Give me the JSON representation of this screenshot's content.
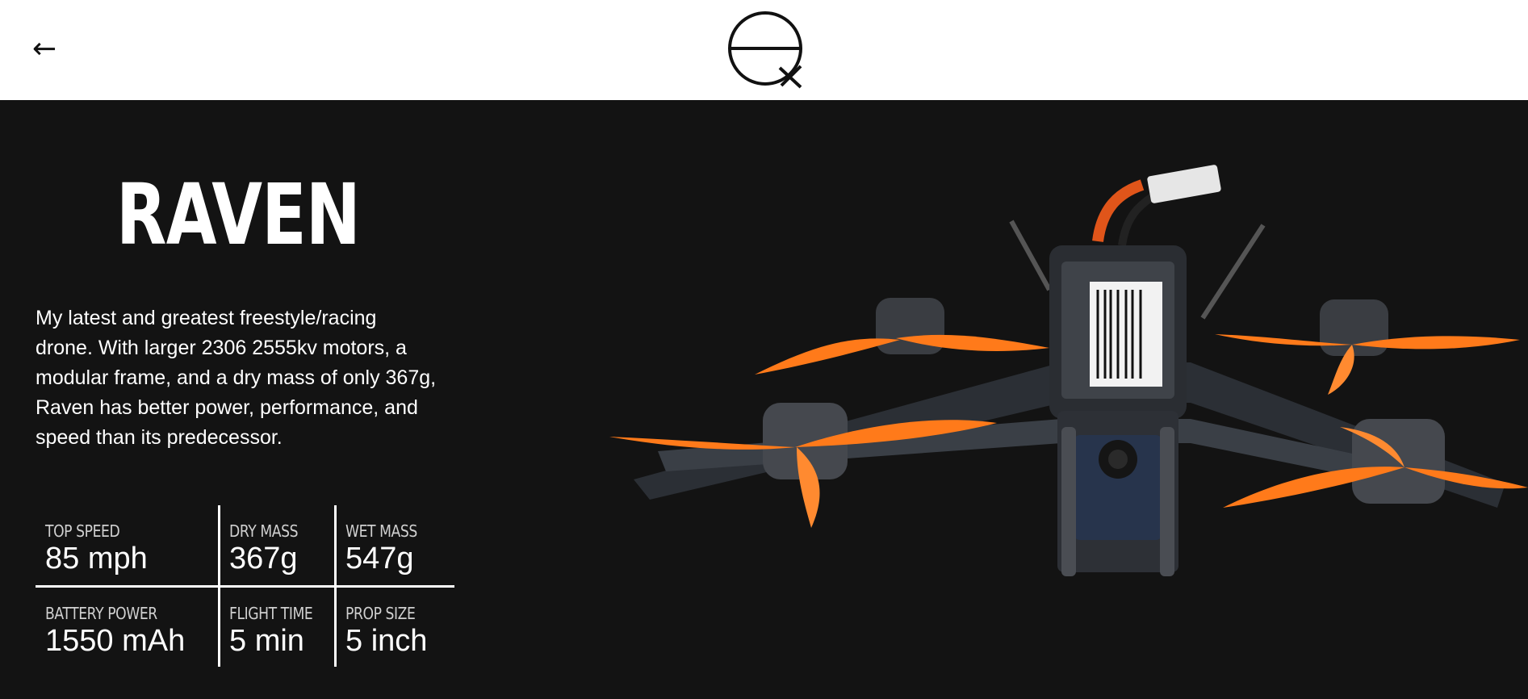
{
  "header": {
    "back_icon": "←",
    "logo_name": "logo"
  },
  "product": {
    "title": "RAVEN",
    "description": "My latest and greatest freestyle/racing drone. With larger 2306 2555kv motors, a modular frame, and a dry mass of only 367g, Raven has better power, performance, and speed than its predecessor."
  },
  "stats": [
    {
      "label": "TOP SPEED",
      "value": "85 mph"
    },
    {
      "label": "DRY MASS",
      "value": "367g"
    },
    {
      "label": "WET MASS",
      "value": "547g"
    },
    {
      "label": "BATTERY POWER",
      "value": "1550 mAh"
    },
    {
      "label": "FLIGHT TIME",
      "value": "5 min"
    },
    {
      "label": "PROP SIZE",
      "value": "5 inch"
    }
  ],
  "colors": {
    "background": "#131313",
    "header": "#ffffff",
    "accent_props": "#ff7a1a",
    "text": "#ffffff"
  }
}
